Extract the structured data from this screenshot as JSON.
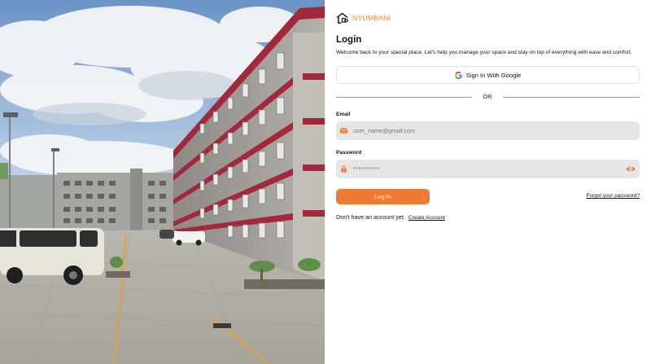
{
  "brand": {
    "name": "NYUMBANI",
    "logo_icon": "home-icon",
    "accent": "#f0883a"
  },
  "login": {
    "title": "Login",
    "subtitle": "Welcome back to your special place. Let's help you manage your space and stay on top of everything with ease and comfort.",
    "google_button": "Sign In With Google",
    "divider_text": "OR",
    "email_label": "Email",
    "email_placeholder": "user_name@gmail.com",
    "email_icon": "envelope-icon",
    "password_label": "Password",
    "password_value": "**********",
    "password_icon": "lock-icon",
    "password_toggle_icon": "eye-icon",
    "submit_label": "Log In",
    "submit_color": "#ef7a33",
    "forgot_link": "Forgot your password?",
    "no_account_text": "Don't have an account yet.",
    "create_account_link": "Create Account"
  },
  "hero_image": {
    "description_icon": "apartment-building-photo"
  }
}
